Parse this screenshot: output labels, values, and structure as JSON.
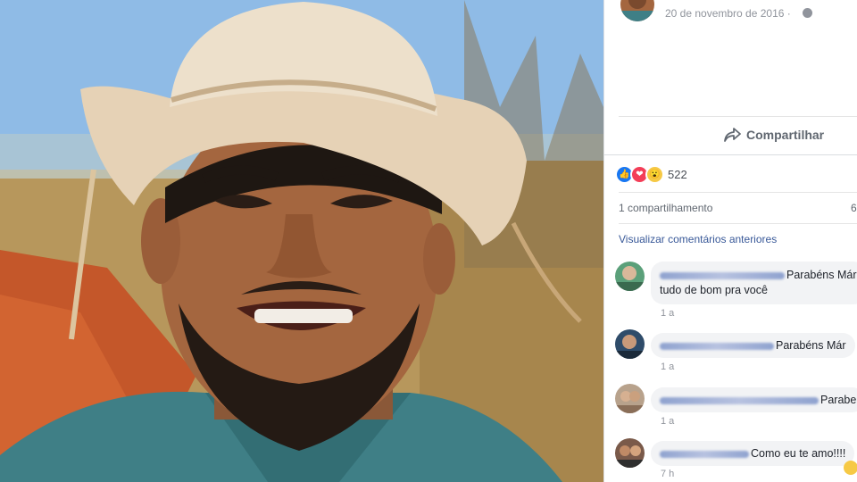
{
  "post": {
    "date": "20 de novembro de 2016 ·",
    "share_label": "Compartilhar",
    "reaction_count": "522",
    "shares_label": "1 compartilhamento",
    "views_label": "6",
    "view_previous_comments": "Visualizar comentários anteriores"
  },
  "comments": [
    {
      "text_line1": "Parabéns Már",
      "text_line2": "tudo de bom pra você",
      "time": "1 a"
    },
    {
      "text_line1": "Parabéns Már",
      "time": "1 a"
    },
    {
      "text_line1": "Parabe",
      "time": "1 a"
    },
    {
      "text_line1": "Como eu te amo!!!!",
      "time": "7 h"
    }
  ],
  "icons": {
    "globe": "globe-icon",
    "share": "share-arrow-icon",
    "like": "like-reaction-icon",
    "love": "love-reaction-icon",
    "wow": "wow-reaction-icon"
  },
  "colors": {
    "link": "#385898",
    "muted": "#90949c",
    "like_blue": "#1877f2",
    "love_red": "#f33e58",
    "wow_yellow": "#f6c945"
  }
}
